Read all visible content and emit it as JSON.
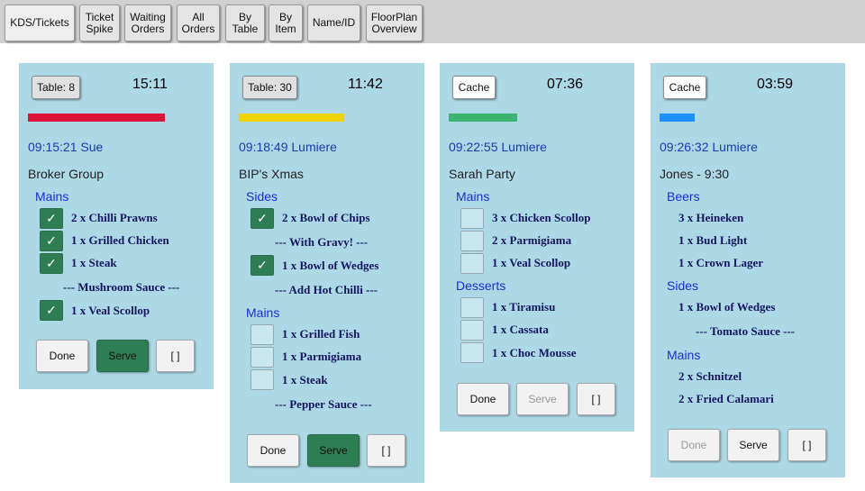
{
  "nav": {
    "tabs": [
      {
        "label": "KDS/Tickets"
      },
      {
        "label": "Ticket\nSpike"
      },
      {
        "label": "Waiting\nOrders"
      },
      {
        "label": "All\nOrders"
      },
      {
        "label": "By\nTable"
      },
      {
        "label": "By\nItem"
      },
      {
        "label": "Name/ID"
      },
      {
        "label": "FloorPlan\nOverview"
      }
    ]
  },
  "colors": {
    "card_bg": "#add8e6",
    "bar_red": "#dc143c",
    "bar_yellow": "#f0d400",
    "bar_green": "#3cb371",
    "bar_blue": "#1e90ff",
    "serve_green": "#2e7d54"
  },
  "tickets": [
    {
      "header_button": "Table: 8",
      "timer": "15:11",
      "progress_color": "#dc143c",
      "timestamp": "09:15:21 Sue",
      "customer": "Broker Group",
      "sections": [
        {
          "title": "Mains",
          "items": [
            {
              "text": "2 x Chilli Prawns",
              "checked": true
            },
            {
              "text": "1 x Grilled Chicken",
              "checked": true
            },
            {
              "text": "1 x Steak",
              "checked": true
            },
            {
              "modifier": "--- Mushroom Sauce ---"
            },
            {
              "text": "1 x Veal Scollop",
              "checked": true
            }
          ]
        }
      ],
      "actions": {
        "done": "Done",
        "serve": "Serve",
        "other": "[ ]"
      }
    },
    {
      "header_button": "Table: 30",
      "timer": "11:42",
      "progress_color": "#f0d400",
      "timestamp": "09:18:49 Lumiere",
      "customer": "BIP's Xmas",
      "sections": [
        {
          "title": "Sides",
          "items": [
            {
              "text": "2 x Bowl of Chips",
              "checked": true
            },
            {
              "modifier": "--- With Gravy! ---"
            },
            {
              "text": "1 x Bowl of Wedges",
              "checked": true
            },
            {
              "modifier": "--- Add Hot Chilli ---"
            }
          ]
        },
        {
          "title": "Mains",
          "items": [
            {
              "text": "1 x Grilled Fish",
              "checked": false
            },
            {
              "text": "1 x Parmigiama",
              "checked": false
            },
            {
              "text": "1 x Steak",
              "checked": false
            },
            {
              "modifier": "--- Pepper Sauce ---"
            }
          ]
        }
      ],
      "actions": {
        "done": "Done",
        "serve": "Serve",
        "other": "[ ]"
      }
    },
    {
      "header_button": "Cache",
      "timer": "07:36",
      "progress_color": "#3cb371",
      "timestamp": "09:22:55 Lumiere",
      "customer": "Sarah Party",
      "sections": [
        {
          "title": "Mains",
          "items": [
            {
              "text": "3 x Chicken Scollop",
              "checked": false
            },
            {
              "text": "2 x Parmigiama",
              "checked": false
            },
            {
              "text": "1 x Veal Scollop",
              "checked": false
            }
          ]
        },
        {
          "title": "Desserts",
          "items": [
            {
              "text": "1 x Tiramisu",
              "checked": false
            },
            {
              "text": "1 x Cassata",
              "checked": false
            },
            {
              "text": "1 x Choc Mousse",
              "checked": false
            }
          ]
        }
      ],
      "actions": {
        "done": "Done",
        "serve": "Serve",
        "other": "[ ]"
      }
    },
    {
      "header_button": "Cache",
      "timer": "03:59",
      "progress_color": "#1e90ff",
      "timestamp": "09:26:32 Lumiere",
      "customer": "Jones - 9:30",
      "sections": [
        {
          "title": "Beers",
          "items": [
            {
              "text": "3 x Heineken"
            },
            {
              "text": "1 x Bud Light"
            },
            {
              "text": "1 x Crown Lager"
            }
          ]
        },
        {
          "title": "Sides",
          "items": [
            {
              "text": "1 x Bowl of Wedges"
            },
            {
              "modifier": "--- Tomato Sauce ---"
            }
          ]
        },
        {
          "title": "Mains",
          "items": [
            {
              "text": "2 x Schnitzel"
            },
            {
              "text": "2 x Fried Calamari"
            }
          ]
        }
      ],
      "actions": {
        "done": "Done",
        "serve": "Serve",
        "other": "[ ]"
      }
    }
  ]
}
